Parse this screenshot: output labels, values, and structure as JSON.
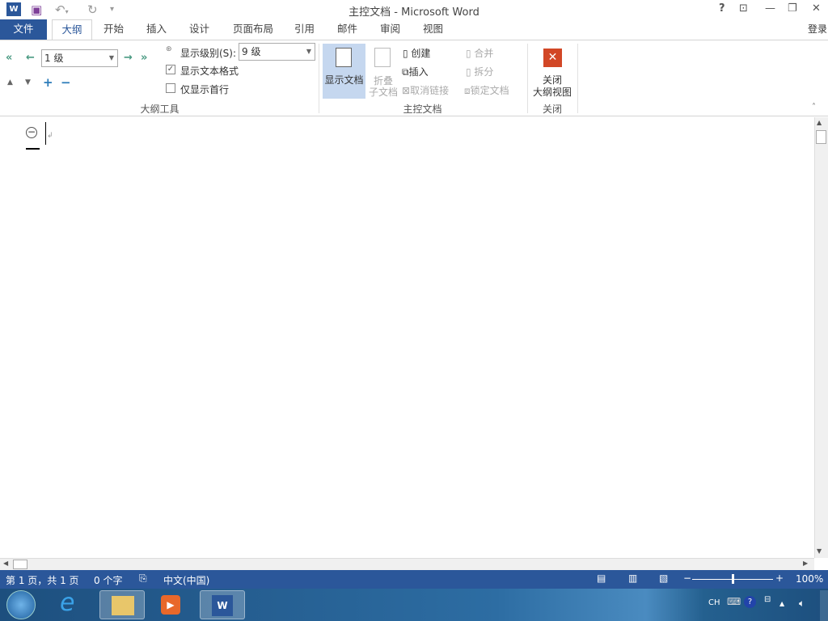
{
  "window": {
    "title": "主控文档 - Microsoft Word",
    "login": "登录",
    "help": "?"
  },
  "tabs": [
    "文件",
    "大纲",
    "开始",
    "插入",
    "设计",
    "页面布局",
    "引用",
    "邮件",
    "审阅",
    "视图"
  ],
  "outline_tools": {
    "level_value": "1 级",
    "show_level_label": "显示级别(S):",
    "show_level_value": "9 级",
    "show_text_format": "显示文本格式",
    "show_text_format_checked": true,
    "show_first_line": "仅显示首行",
    "show_first_line_checked": false,
    "group_label": "大纲工具"
  },
  "master_document": {
    "show_document": "显示文档",
    "collapse_1": "折叠",
    "collapse_2": "子文档",
    "create": "创建",
    "insert": "插入",
    "unlink": "取消链接",
    "merge": "合并",
    "split": "拆分",
    "lock": "锁定文档",
    "group_label": "主控文档"
  },
  "close": {
    "button_1": "关闭",
    "button_2": "大纲视图",
    "group_label": "关闭"
  },
  "status": {
    "page": "第 1 页，共 1 页",
    "words": "0 个字",
    "language": "中文(中国)",
    "zoom": "100%",
    "zoom_percent": 100
  },
  "taskbar": {
    "lang": "CH"
  }
}
